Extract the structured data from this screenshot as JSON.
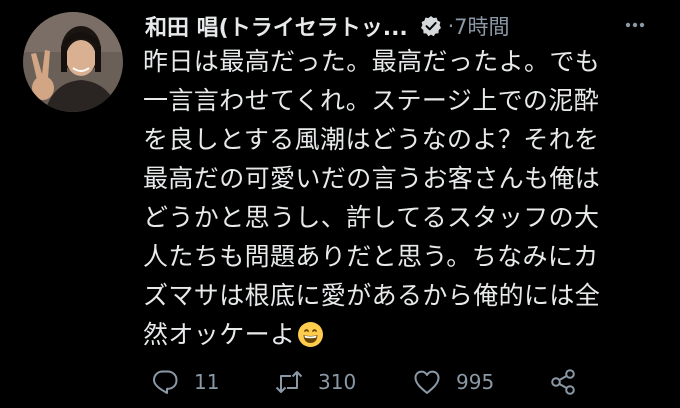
{
  "tweet": {
    "author": {
      "display_name": "和田 唱(トライセラトッ...",
      "avatar_icon": "user-avatar-photo",
      "verified_icon": "verified-badge-icon"
    },
    "separator": "·",
    "timestamp": "7時間",
    "text_lines": [
      "昨日は最高だった。最高だったよ。でも",
      "一言言わせてくれ。ステージ上での泥酔",
      "を良しとする風潮はどうなのよ？それを",
      "最高だの可愛いだの言うお客さんも俺は",
      "どうかと思うし、許してるスタッフの大",
      "人たちも問題ありだと思う。ちなみにカ",
      "ズマサは根底に愛があるから俺的には全",
      "然オッケーよ"
    ],
    "emoji_icon": "grinning-face-emoji",
    "actions": {
      "reply": {
        "icon": "reply-icon",
        "count": "11"
      },
      "retweet": {
        "icon": "retweet-icon",
        "count": "310"
      },
      "like": {
        "icon": "heart-icon",
        "count": "995"
      },
      "share": {
        "icon": "share-icon"
      }
    },
    "more_icon": "more-options-icon"
  },
  "colors": {
    "background": "#000000",
    "text_primary": "#e7e9ea",
    "text_secondary": "#8b98a5"
  }
}
